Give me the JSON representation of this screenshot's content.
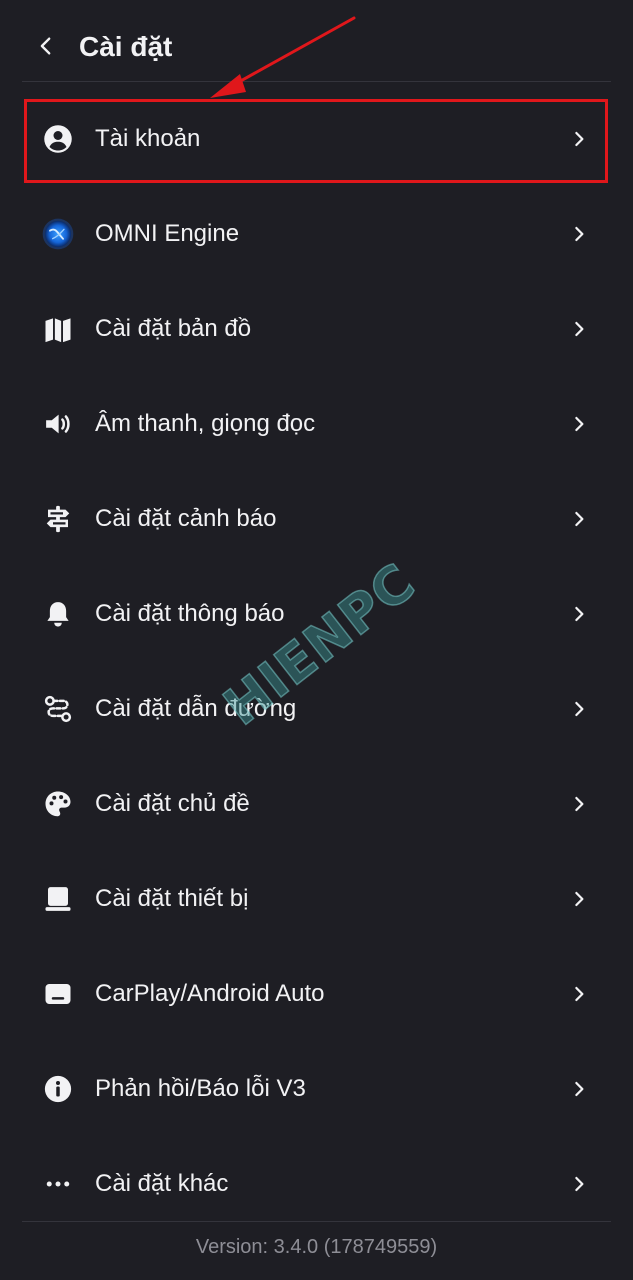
{
  "header": {
    "title": "Cài đặt",
    "back_icon": "chevron-left-icon"
  },
  "menu": {
    "items": [
      {
        "label": "Tài khoản",
        "icon": "account-circle-icon",
        "highlighted": true
      },
      {
        "label": "OMNI Engine",
        "icon": "omni-engine-globe-icon"
      },
      {
        "label": "Cài đặt bản đồ",
        "icon": "map-icon"
      },
      {
        "label": "Âm thanh, giọng đọc",
        "icon": "speaker-icon"
      },
      {
        "label": "Cài đặt cảnh báo",
        "icon": "signpost-icon"
      },
      {
        "label": "Cài đặt thông báo",
        "icon": "bell-icon"
      },
      {
        "label": "Cài đặt dẫn đường",
        "icon": "route-icon"
      },
      {
        "label": "Cài đặt chủ đề",
        "icon": "palette-icon"
      },
      {
        "label": "Cài đặt thiết bị",
        "icon": "device-icon"
      },
      {
        "label": "CarPlay/Android Auto",
        "icon": "car-screen-icon"
      },
      {
        "label": "Phản hồi/Báo lỗi V3",
        "icon": "info-icon"
      },
      {
        "label": "Cài đặt khác",
        "icon": "more-dots-icon"
      }
    ],
    "chevron_icon": "chevron-right-icon"
  },
  "footer": {
    "version": "Version: 3.4.0 (178749559)"
  },
  "watermark": {
    "text": "HIENPC"
  },
  "colors": {
    "background": "#1e1e24",
    "text": "#f2f2f4",
    "muted_text": "#8e8e96",
    "divider": "#34343c",
    "highlight": "#e0171b",
    "watermark": "#3c9696"
  }
}
